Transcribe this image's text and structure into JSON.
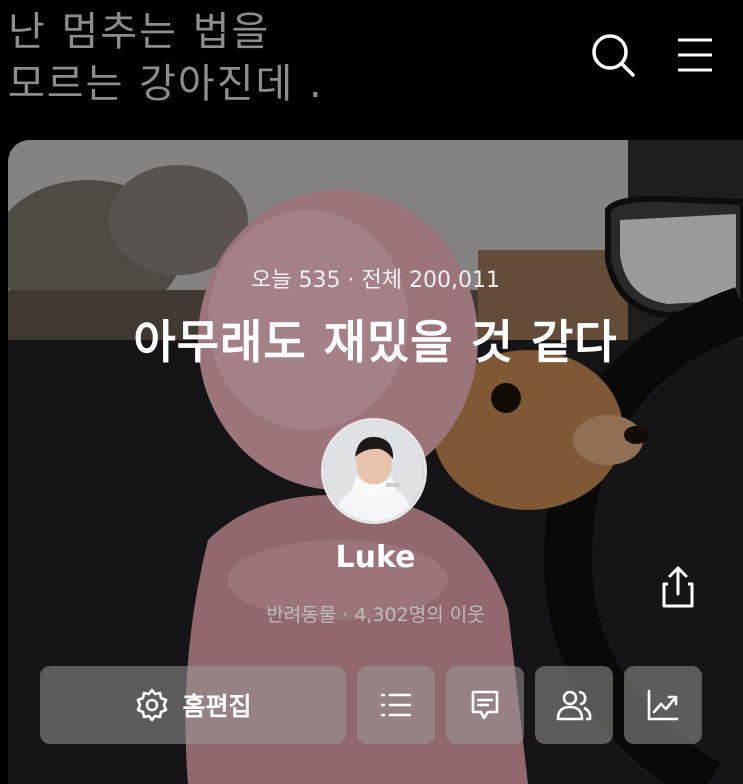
{
  "header": {
    "blog_title": "난 멈추는 법을\n모르는 강아진데 ."
  },
  "icons": {
    "search": "search-icon",
    "menu": "hamburger-menu-icon",
    "share": "share-icon",
    "settings": "gear-icon",
    "list": "list-icon",
    "comment": "comment-icon",
    "neighbors": "people-icon",
    "stats": "chart-icon"
  },
  "profile": {
    "visits": "오늘 535  ·  전체 200,011",
    "headline": "아무래도 재밌을 것 같다",
    "nickname": "Luke",
    "meta": "반려동물 · 4,302명의 이웃"
  },
  "actions": {
    "edit_label": "홈편집"
  }
}
